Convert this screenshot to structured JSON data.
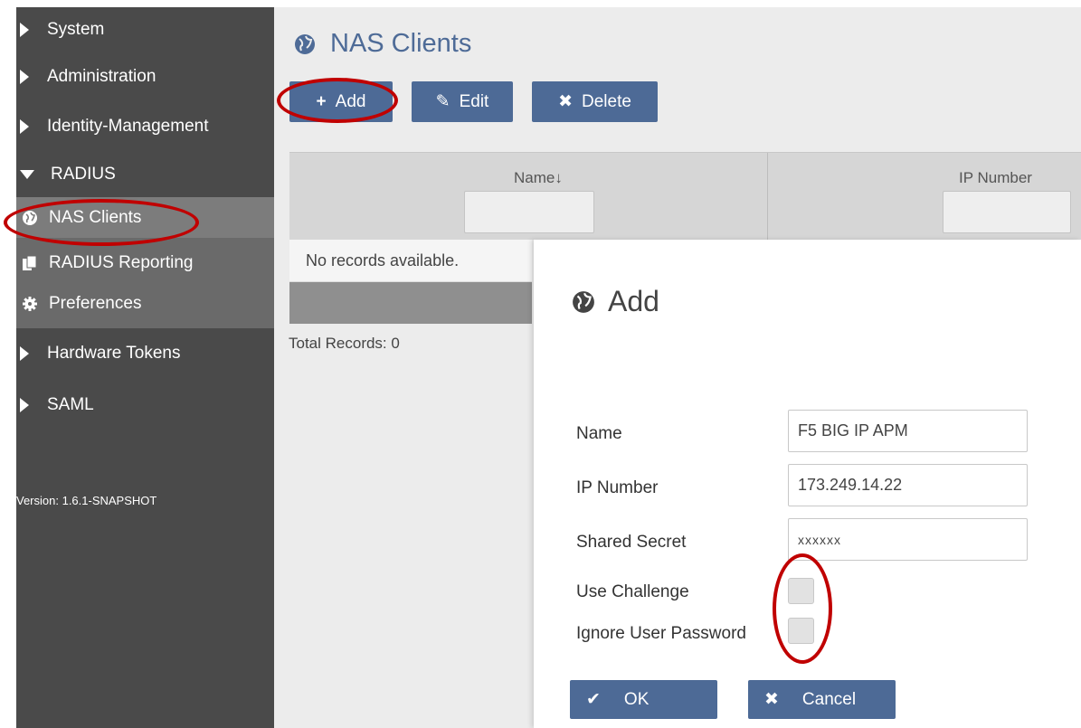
{
  "sidebar": {
    "items": [
      {
        "label": "System"
      },
      {
        "label": "Administration"
      },
      {
        "label": "Identity-Management"
      },
      {
        "label": "RADIUS"
      }
    ],
    "radius_sub": [
      {
        "label": "NAS Clients",
        "icon": "globe-icon"
      },
      {
        "label": "RADIUS Reporting",
        "icon": "report-icon"
      },
      {
        "label": "Preferences",
        "icon": "gear-icon"
      }
    ],
    "items_after": [
      {
        "label": "Hardware Tokens"
      },
      {
        "label": "SAML"
      }
    ],
    "version": "Version: 1.6.1-SNAPSHOT"
  },
  "main": {
    "title": "NAS Clients",
    "toolbar": {
      "add_label": "Add",
      "edit_label": "Edit",
      "delete_label": "Delete"
    },
    "grid": {
      "col_name": "Name",
      "sort_glyph": "↓",
      "col_ip": "IP Number",
      "empty_text": "No records available.",
      "total": "Total Records: 0"
    }
  },
  "dialog": {
    "title": "Add",
    "labels": {
      "name": "Name",
      "ip": "IP Number",
      "secret": "Shared Secret",
      "challenge": "Use Challenge",
      "ignore_pw": "Ignore User Password"
    },
    "values": {
      "name": "F5 BIG IP APM",
      "ip": "173.249.14.22",
      "secret": "xxxxxx"
    },
    "ok_label": "OK",
    "cancel_label": "Cancel"
  },
  "colors": {
    "accent": "#4d6a96",
    "sidebar_bg": "#4a4a4a",
    "annotation": "#c00000"
  }
}
